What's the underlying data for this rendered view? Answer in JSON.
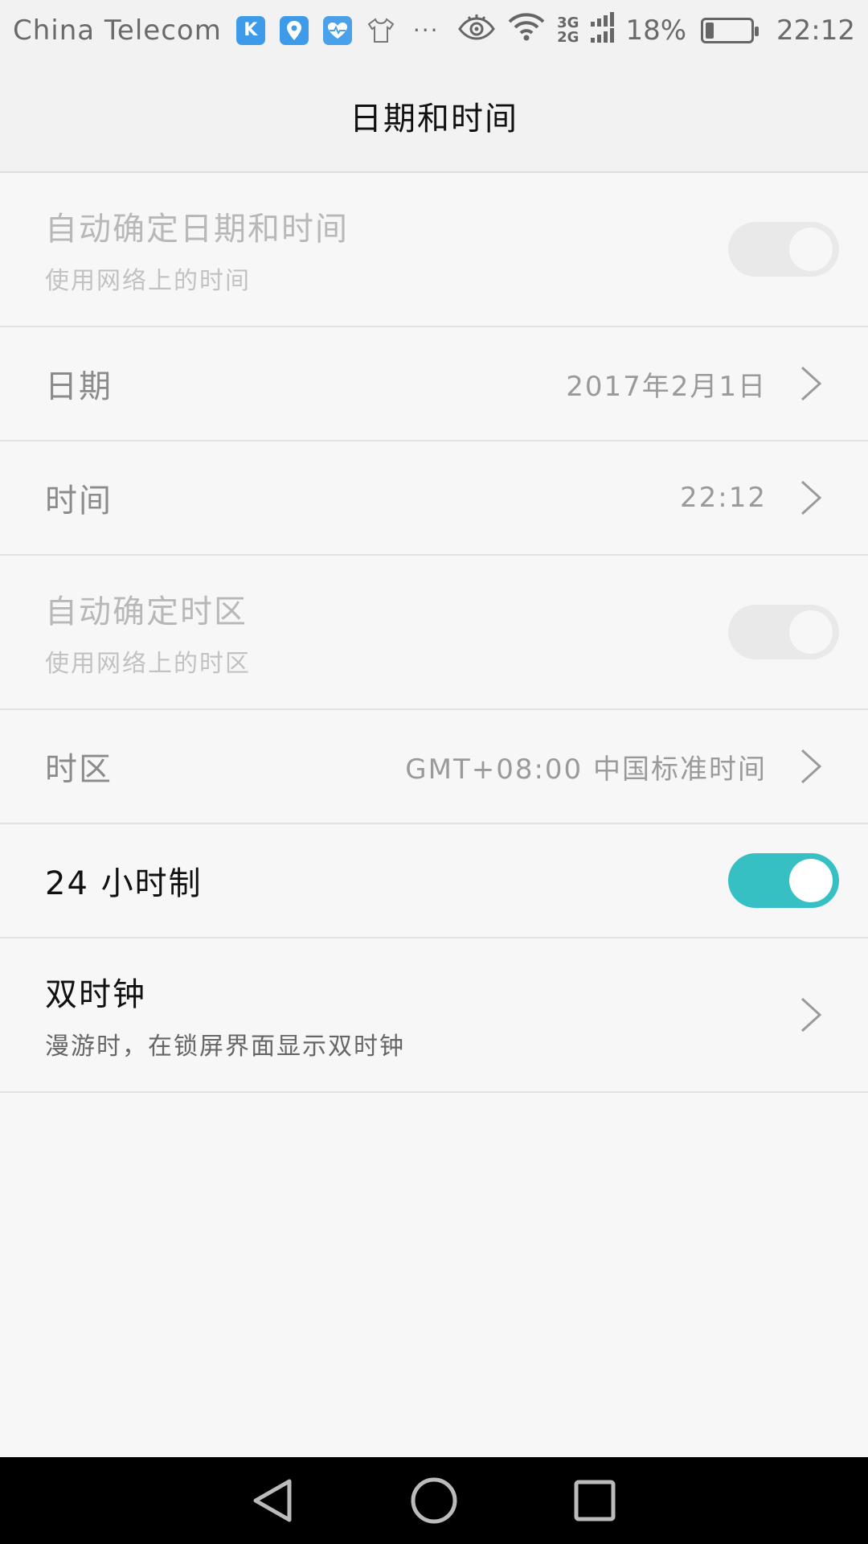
{
  "status_bar": {
    "carrier": "China Telecom",
    "apps": [
      "K",
      "location",
      "heart",
      "shirt"
    ],
    "more": "···",
    "net_top": "3G",
    "net_bottom": "2G",
    "battery_percent": "18%",
    "time": "22:12"
  },
  "header": {
    "title": "日期和时间"
  },
  "settings": [
    {
      "title": "自动确定日期和时间",
      "subtitle": "使用网络上的时间",
      "toggle": "off-disabled"
    },
    {
      "title": "日期",
      "value": "2017年2月1日"
    },
    {
      "title": "时间",
      "value": "22:12"
    },
    {
      "title": "自动确定时区",
      "subtitle": "使用网络上的时区",
      "toggle": "off-disabled"
    },
    {
      "title": "时区",
      "value": "GMT+08:00 中国标准时间"
    },
    {
      "title": "24 小时制",
      "toggle": "on"
    },
    {
      "title": "双时钟",
      "subtitle": "漫游时，在锁屏界面显示双时钟"
    }
  ],
  "colors": {
    "accent": "#36c0c4",
    "background": "#f7f7f7",
    "header_bg": "#f2f2f2",
    "nav_bg": "#000000"
  },
  "nav": [
    "back-icon",
    "home-icon",
    "recents-icon"
  ]
}
